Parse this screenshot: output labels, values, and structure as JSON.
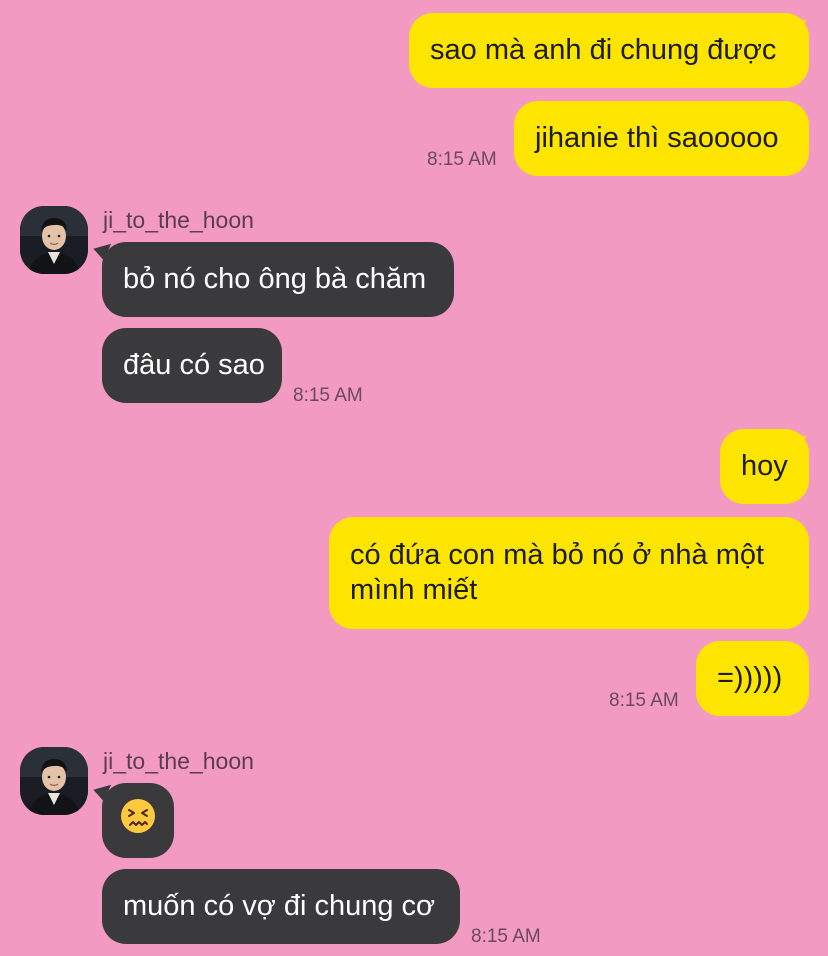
{
  "colors": {
    "background": "#f39ac3",
    "outgoing_bubble": "#fee500",
    "incoming_bubble": "#3a3a3c"
  },
  "messages": {
    "m1": "sao mà anh đi chung được",
    "m2": "jihanie thì saooooo",
    "m2_time": "8:15 AM",
    "sender1_name": "ji_to_the_hoon",
    "m3": "bỏ nó cho ông bà chăm",
    "m4": "đâu có sao",
    "m4_time": "8:15 AM",
    "m5": "hoy",
    "m6": "có đứa con mà bỏ nó ở nhà một mình miết",
    "m7": "=)))))",
    "m7_time": "8:15 AM",
    "sender2_name": "ji_to_the_hoon",
    "m8_emoji": "confounded-face-emoji",
    "m9": "muốn có vợ đi chung cơ",
    "m9_time": "8:15 AM"
  }
}
